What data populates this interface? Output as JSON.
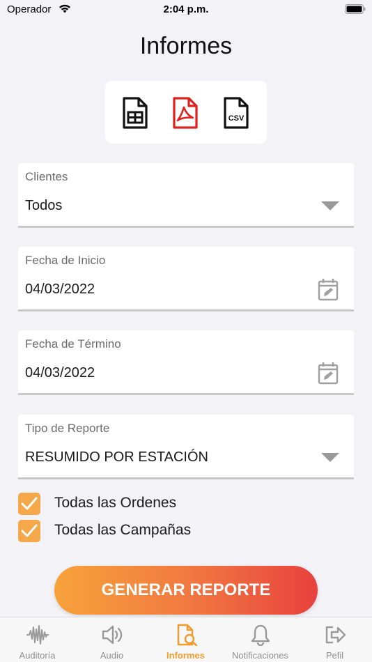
{
  "status_bar": {
    "carrier": "Operador",
    "time": "2:04 p.m."
  },
  "page": {
    "title": "Informes"
  },
  "export": {
    "buttons": [
      {
        "name": "spreadsheet-export-icon",
        "color": "#111111"
      },
      {
        "name": "pdf-export-icon",
        "color": "#e0201c"
      },
      {
        "name": "csv-export-icon",
        "color": "#111111",
        "text": "CSV"
      }
    ]
  },
  "form": {
    "clientes": {
      "label": "Clientes",
      "value": "Todos"
    },
    "fecha_inicio": {
      "label": "Fecha de Inicio",
      "value": "04/03/2022"
    },
    "fecha_termino": {
      "label": "Fecha de Término",
      "value": "04/03/2022"
    },
    "tipo_reporte": {
      "label": "Tipo de Reporte",
      "value": "RESUMIDO POR ESTACIÓN"
    }
  },
  "checks": {
    "ordenes": {
      "label": "Todas las Ordenes",
      "checked": true
    },
    "campanas": {
      "label": "Todas las Campañas",
      "checked": true
    }
  },
  "actions": {
    "generate_label": "GENERAR REPORTE"
  },
  "tabs": [
    {
      "label": "Auditoría",
      "icon": "waveform-icon"
    },
    {
      "label": "Audio",
      "icon": "speaker-icon"
    },
    {
      "label": "Informes",
      "icon": "document-search-icon",
      "active": true
    },
    {
      "label": "Notificaciones",
      "icon": "bell-icon"
    },
    {
      "label": "Pefil",
      "icon": "logout-icon"
    }
  ],
  "colors": {
    "accent": "#f39a2c",
    "checkbox": "#f5a84a",
    "pdf": "#e0201c"
  }
}
